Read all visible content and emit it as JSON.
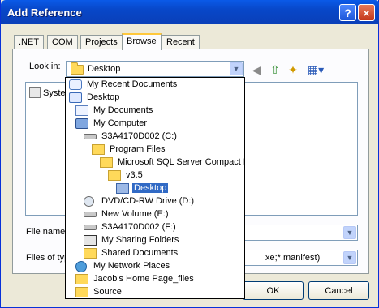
{
  "window": {
    "title": "Add Reference",
    "help_label": "?",
    "close_label": "×"
  },
  "tabs": [
    ".NET",
    "COM",
    "Projects",
    "Browse",
    "Recent"
  ],
  "active_tab": "Browse",
  "look_in": {
    "label": "Look in:",
    "value": "Desktop"
  },
  "file_list": {
    "items": [
      "Syste"
    ]
  },
  "file_name": {
    "label": "File name",
    "value": ""
  },
  "files_of_type": {
    "label": "Files of typ",
    "value": "xe;*.manifest)"
  },
  "buttons": {
    "ok": "OK",
    "cancel": "Cancel"
  },
  "dropdown": {
    "selected": "Desktop",
    "items": [
      {
        "label": "My Recent Documents",
        "icon": "recent-documents-icon",
        "level": 0
      },
      {
        "label": "Desktop",
        "icon": "desktop-icon",
        "level": 0
      },
      {
        "label": "My Documents",
        "icon": "my-documents-icon",
        "level": 1
      },
      {
        "label": "My Computer",
        "icon": "computer-icon",
        "level": 1
      },
      {
        "label": "S3A4170D002 (C:)",
        "icon": "drive-icon",
        "level": 2
      },
      {
        "label": "Program Files",
        "icon": "folder-icon",
        "level": 3
      },
      {
        "label": "Microsoft SQL Server Compact E",
        "icon": "folder-icon",
        "level": 4
      },
      {
        "label": "v3.5",
        "icon": "folder-icon",
        "level": 5
      },
      {
        "label": "Desktop",
        "icon": "folder-icon",
        "level": 6
      },
      {
        "label": "DVD/CD-RW Drive (D:)",
        "icon": "cd-drive-icon",
        "level": 2
      },
      {
        "label": "New Volume (E:)",
        "icon": "drive-icon",
        "level": 2
      },
      {
        "label": "S3A4170D002 (F:)",
        "icon": "drive-icon",
        "level": 2
      },
      {
        "label": "My Sharing Folders",
        "icon": "sharing-folders-icon",
        "level": 2
      },
      {
        "label": "Shared Documents",
        "icon": "folder-icon",
        "level": 2
      },
      {
        "label": "My Network Places",
        "icon": "network-places-icon",
        "level": 1
      },
      {
        "label": "Jacob's Home Page_files",
        "icon": "folder-icon",
        "level": 1
      },
      {
        "label": "Source",
        "icon": "folder-icon",
        "level": 1
      }
    ]
  }
}
